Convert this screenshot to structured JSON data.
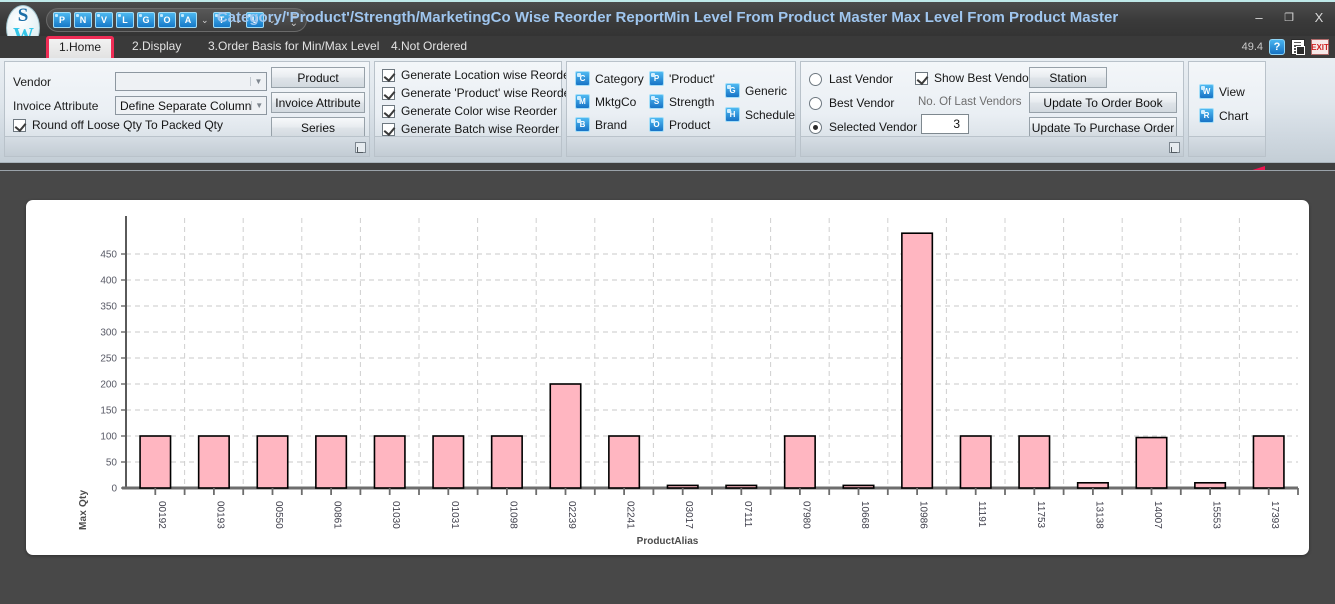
{
  "window": {
    "title": "Category/'Product'/Strength/MarketingCo Wise Reorder ReportMin Level From Product Master Max Level From Product Master",
    "minimize": "–",
    "maximize": "❐",
    "close": "X",
    "version": "49.4",
    "help_icon": "?",
    "doc_icon": "document-icon",
    "exit_icon": "EXIT"
  },
  "quick_access": {
    "buttons": [
      "P",
      "N",
      "V",
      "L",
      "G",
      "O",
      "A",
      "T",
      "U"
    ],
    "dropdown_glyph": "⌄",
    "overflow_glyph": "☰"
  },
  "tabs": [
    {
      "label": "1.Home",
      "active": true
    },
    {
      "label": "2.Display",
      "active": false
    },
    {
      "label": "3.Order Basis for Min/Max Level",
      "active": false
    },
    {
      "label": "4.Not Ordered",
      "active": false
    }
  ],
  "group_vendor": {
    "vendor_label": "Vendor",
    "vendor_value": "",
    "invoice_attribute_label": "Invoice Attribute",
    "invoice_attribute_value": "Define Separate Column",
    "round_off_label": "Round off Loose Qty To Packed Qty",
    "round_off_checked": true,
    "buttons": [
      "Product",
      "Invoice Attribute",
      "Series"
    ]
  },
  "group_generate": {
    "items": [
      {
        "label": "Generate Location wise Reorder",
        "checked": true
      },
      {
        "label": "Generate 'Product' wise Reorder",
        "checked": true
      },
      {
        "label": "Generate Color wise Reorder",
        "checked": true
      },
      {
        "label": "Generate Batch wise Reorder",
        "checked": true
      }
    ]
  },
  "group_dimensions": {
    "items": [
      {
        "label": "Category",
        "icon": "C"
      },
      {
        "label": "MktgCo",
        "icon": "M"
      },
      {
        "label": "Brand",
        "icon": "B"
      },
      {
        "label": "'Product'",
        "icon": "P"
      },
      {
        "label": "Strength",
        "icon": "S"
      },
      {
        "label": "Product",
        "icon": "O"
      },
      {
        "label": "Generic",
        "icon": "G"
      },
      {
        "label": "Schedule",
        "icon": "H"
      }
    ]
  },
  "group_vendor_options": {
    "radios": [
      {
        "label": "Last Vendor",
        "selected": false
      },
      {
        "label": "Best Vendor",
        "selected": false
      },
      {
        "label": "Selected Vendor",
        "selected": true
      }
    ],
    "show_best_vendor_label": "Show Best Vendor",
    "show_best_vendor_checked": true,
    "no_of_last_vendors_label": "No. Of Last Vendors",
    "no_of_last_vendors_value": "3",
    "buttons": [
      "Station",
      "Update To Order Book",
      "Update To Purchase Order"
    ]
  },
  "group_view": {
    "items": [
      {
        "label": "View",
        "icon": "W"
      },
      {
        "label": "Chart",
        "icon": "R"
      }
    ],
    "annotation_arrow_color": "#ed1651"
  },
  "chart_data": {
    "type": "bar",
    "title": "",
    "xlabel": "ProductAlias",
    "ylabel": "Max Qty",
    "ylim": [
      0,
      500
    ],
    "yticks": [
      0,
      50,
      100,
      150,
      200,
      250,
      300,
      350,
      400,
      450
    ],
    "grid": true,
    "bar_fill": "#ffb6c1",
    "bar_stroke": "#000000",
    "categories": [
      "00192",
      "00193",
      "00550",
      "00861",
      "01030",
      "01031",
      "01098",
      "02239",
      "02241",
      "03017",
      "07111",
      "07980",
      "10668",
      "10986",
      "11191",
      "11753",
      "13138",
      "14007",
      "15553",
      "17393"
    ],
    "values": [
      100,
      100,
      100,
      100,
      100,
      100,
      100,
      200,
      100,
      5,
      5,
      100,
      5,
      490,
      100,
      100,
      10,
      97,
      10,
      100
    ]
  }
}
